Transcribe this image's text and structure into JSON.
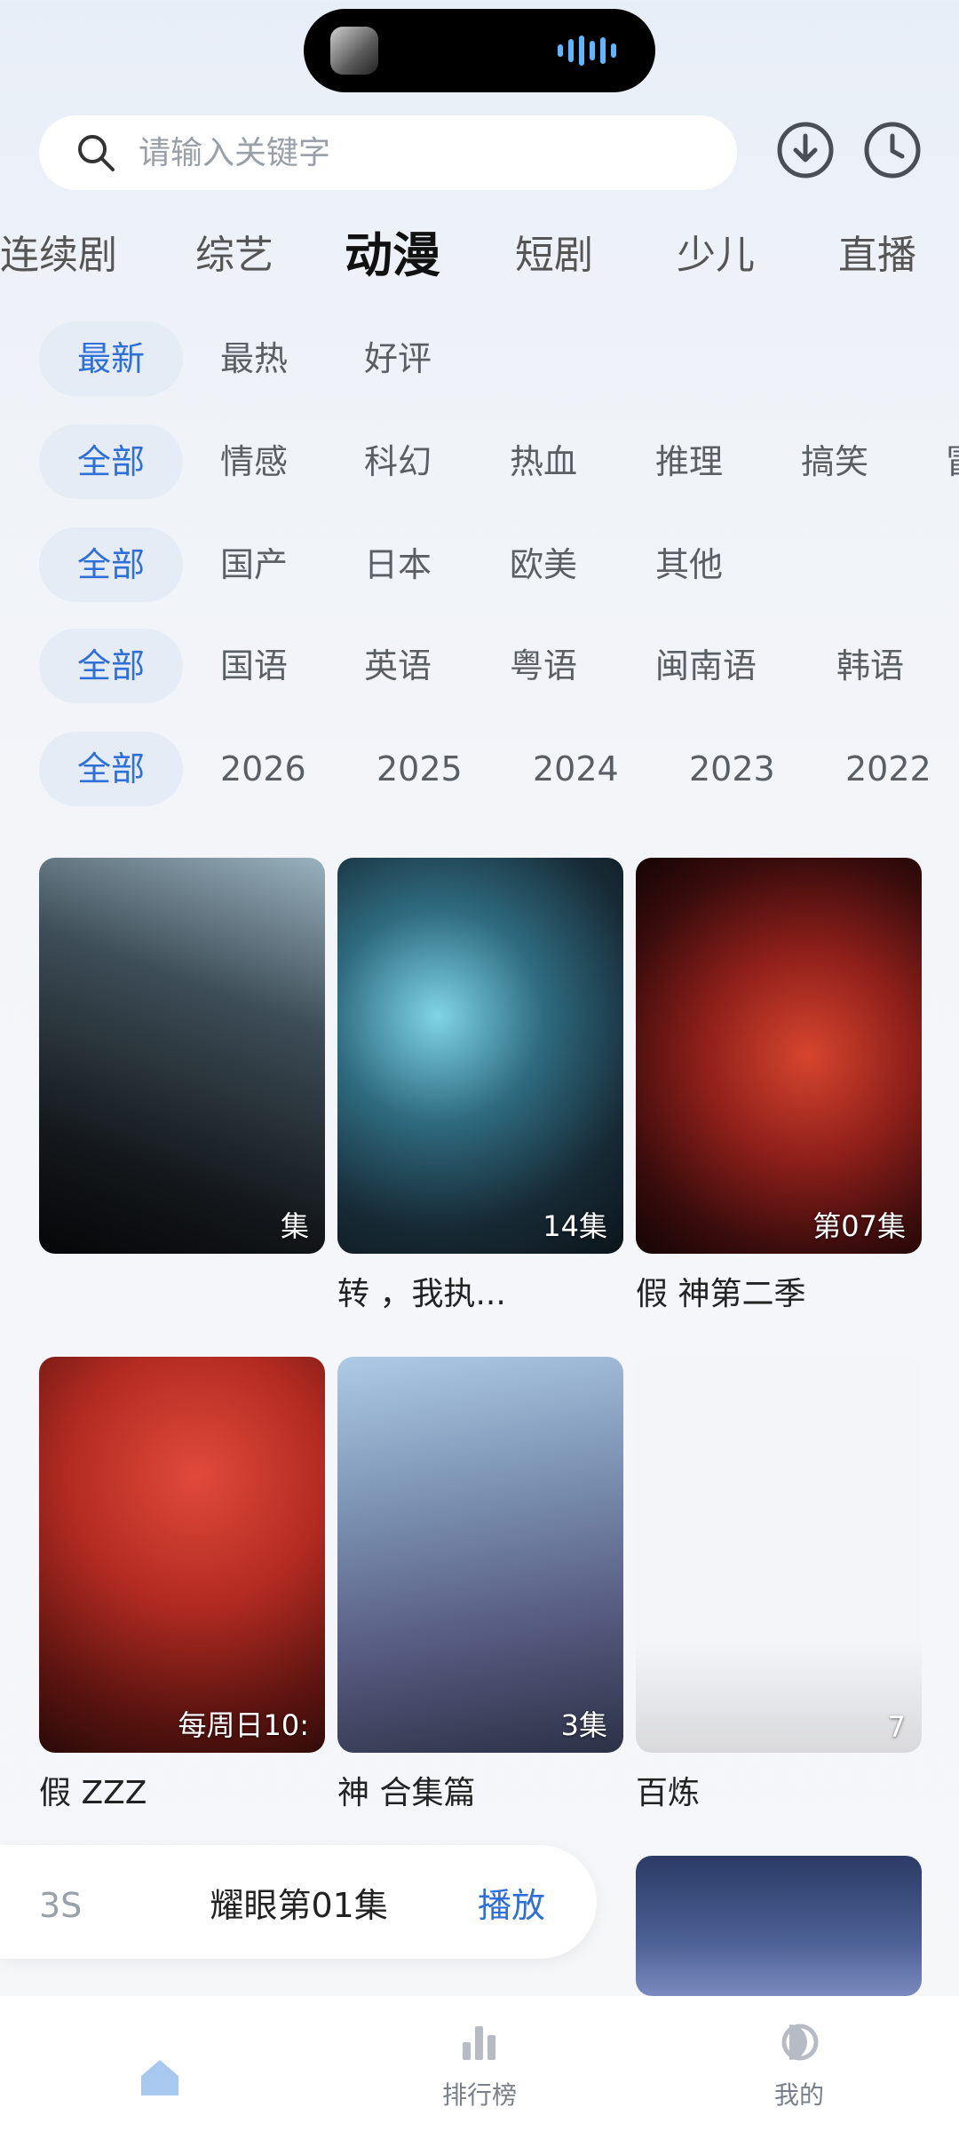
{
  "search": {
    "placeholder": "请输入关键字"
  },
  "category_tabs": [
    {
      "label": "连续剧"
    },
    {
      "label": "综艺"
    },
    {
      "label": "动漫",
      "active": true
    },
    {
      "label": "短剧"
    },
    {
      "label": "少儿"
    },
    {
      "label": "直播"
    }
  ],
  "filters": {
    "sort": [
      "最新",
      "最热",
      "好评"
    ],
    "genre": [
      "全部",
      "情感",
      "科幻",
      "热血",
      "推理",
      "搞笑",
      "冒"
    ],
    "region": [
      "全部",
      "国产",
      "日本",
      "欧美",
      "其他"
    ],
    "language": [
      "全部",
      "国语",
      "英语",
      "粤语",
      "闽南语",
      "韩语"
    ],
    "year": [
      "全部",
      "2026",
      "2025",
      "2024",
      "2023",
      "2022"
    ]
  },
  "cards": [
    {
      "episode": "集",
      "title": ""
    },
    {
      "episode": "14集",
      "title": "转 ，我执..."
    },
    {
      "episode": "第07集",
      "title": "假 神第二季"
    },
    {
      "episode": "每周日10:",
      "title": "假 ZZZ"
    },
    {
      "episode": "3集",
      "title": "神 合集篇"
    },
    {
      "episode": "7",
      "title": "百炼"
    },
    {
      "episode": "",
      "title": ""
    }
  ],
  "resume": {
    "prefix": "3S",
    "title": "耀眼第01集",
    "button": "播放"
  },
  "bottom_nav": [
    {
      "label": ""
    },
    {
      "label": "排行榜"
    },
    {
      "label": "我的"
    }
  ],
  "colors": {
    "accent": "#2f6fd8",
    "chip_selected_bg": "#e6ecf5"
  }
}
